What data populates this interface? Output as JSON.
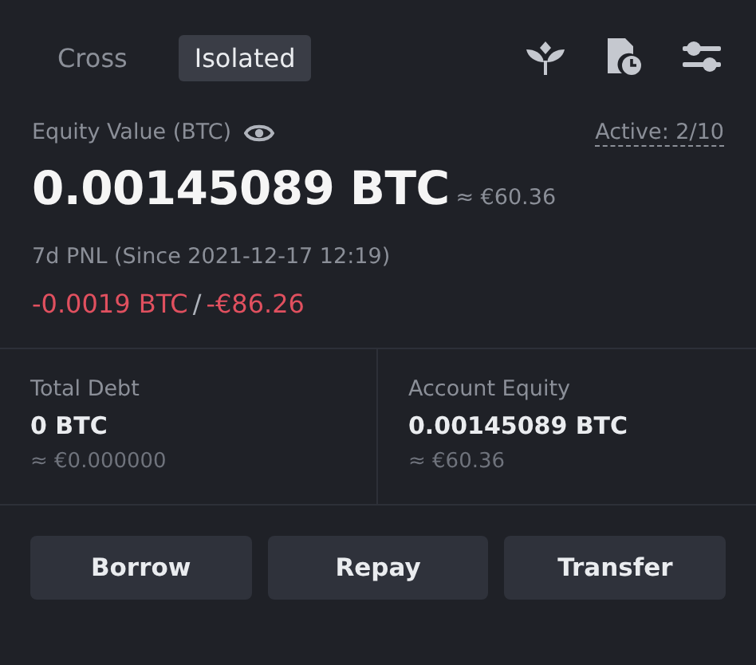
{
  "tabs": [
    {
      "label": "Cross",
      "selected": false
    },
    {
      "label": "Isolated",
      "selected": true
    }
  ],
  "equity": {
    "label": "Equity Value (BTC)",
    "active": "Active: 2/10",
    "value": "0.00145089 BTC",
    "approx": "≈ €60.36"
  },
  "pnl": {
    "label": "7d PNL (Since 2021-12-17 12:19)",
    "btc": "-0.0019 BTC",
    "separator": "/",
    "eur": "-€86.26"
  },
  "stats": [
    {
      "label": "Total Debt",
      "value": "0 BTC",
      "approx": "≈ €0.000000"
    },
    {
      "label": "Account Equity",
      "value": "0.00145089 BTC",
      "approx": "≈ €60.36"
    }
  ],
  "buttons": [
    "Borrow",
    "Repay",
    "Transfer"
  ]
}
